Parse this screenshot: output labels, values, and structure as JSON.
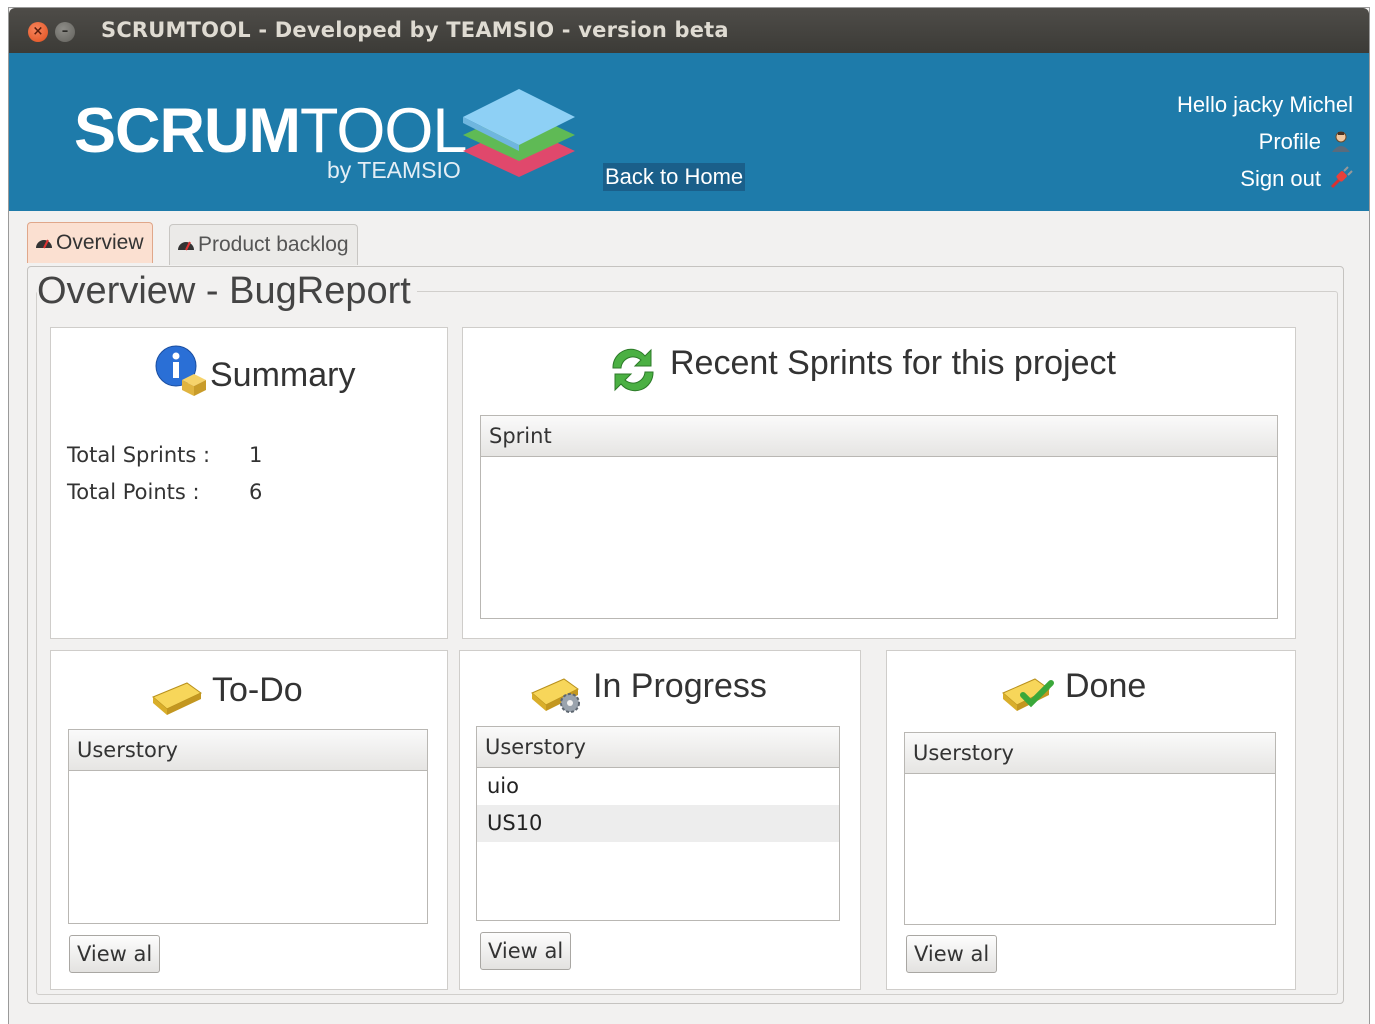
{
  "window": {
    "title": "SCRUMTOOL - Developed by TEAMSIO - version beta"
  },
  "header": {
    "logo_bold": "SCRUM",
    "logo_light": "TOOL",
    "logo_sub": "by TEAMSIO",
    "back_home": "Back to Home",
    "greeting": "Hello jacky Michel",
    "profile": "Profile",
    "sign_out": "Sign out"
  },
  "tabs": [
    {
      "label": "Overview",
      "active": true
    },
    {
      "label": "Product backlog",
      "active": false
    }
  ],
  "page_title": "Overview - BugReport",
  "summary": {
    "title": "Summary",
    "total_sprints_label": "Total Sprints :",
    "total_sprints_value": "1",
    "total_points_label": "Total Points :",
    "total_points_value": "6"
  },
  "recent_sprints": {
    "title": "Recent Sprints for this project",
    "column": "Sprint",
    "rows": []
  },
  "todo": {
    "title": "To-Do",
    "column": "Userstory",
    "rows": [],
    "button": "View al"
  },
  "in_progress": {
    "title": "In Progress",
    "column": "Userstory",
    "rows": [
      "uio",
      "US10"
    ],
    "button": "View al"
  },
  "done": {
    "title": "Done",
    "column": "Userstory",
    "rows": [],
    "button": "View al"
  },
  "colors": {
    "header": "#1e7baa",
    "titlebar": "#3c3b37",
    "active_tab": "#fbe0d1"
  }
}
